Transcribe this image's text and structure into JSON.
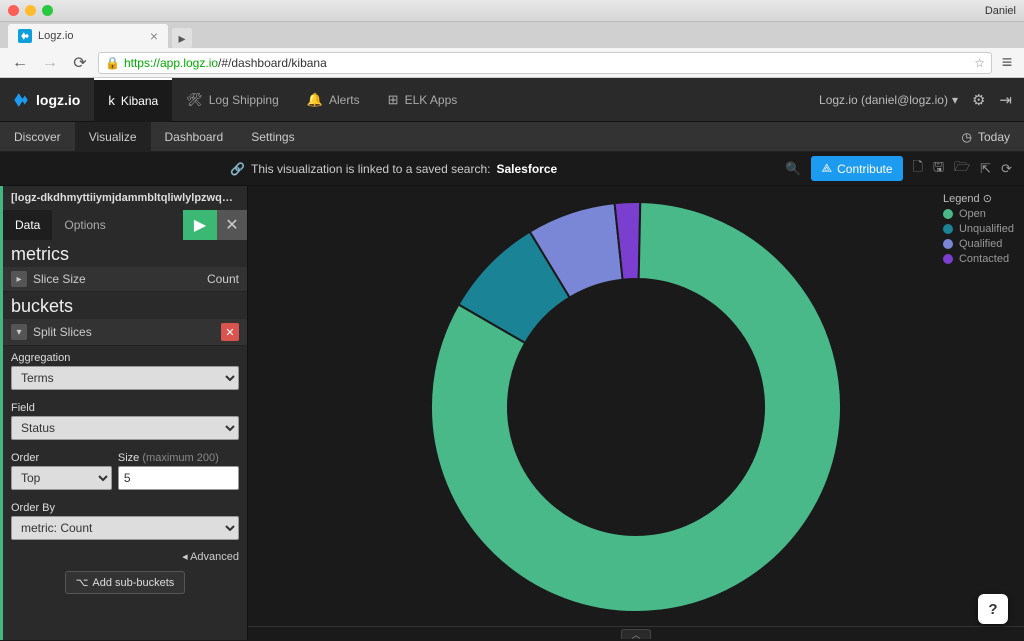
{
  "mac": {
    "user": "Daniel"
  },
  "browser": {
    "tab_title": "Logz.io",
    "url_secure": "https://",
    "url_host": "app.logz.io",
    "url_path": "/#/dashboard/kibana"
  },
  "topnav": {
    "logo": "logz.io",
    "items": [
      "Kibana",
      "Log Shipping",
      "Alerts",
      "ELK Apps"
    ],
    "user_label": "Logz.io (daniel@logz.io)"
  },
  "subnav": {
    "items": [
      "Discover",
      "Visualize",
      "Dashboard",
      "Settings"
    ],
    "today": "Today"
  },
  "banner": {
    "text": "This visualization is linked to a saved search:",
    "search_name": "Salesforce",
    "contribute": "Contribute"
  },
  "left": {
    "index_pattern": "[logz-dkdhmyttiiymjdammbltqliwlylpzwqb-]YYMMDD",
    "tab_data": "Data",
    "tab_options": "Options",
    "metrics_header": "metrics",
    "slice_size": "Slice Size",
    "count": "Count",
    "buckets_header": "buckets",
    "split_slices": "Split Slices",
    "agg_label": "Aggregation",
    "agg_value": "Terms",
    "field_label": "Field",
    "field_value": "Status",
    "order_label": "Order",
    "order_value": "Top",
    "size_label": "Size",
    "size_hint": "(maximum 200)",
    "size_value": "5",
    "orderby_label": "Order By",
    "orderby_value": "metric: Count",
    "advanced": "◂ Advanced",
    "add_sub": "Add sub-buckets"
  },
  "legend": {
    "title": "Legend ⊙",
    "items": [
      {
        "label": "Open",
        "color": "#49b98a"
      },
      {
        "label": "Unqualified",
        "color": "#1b8396"
      },
      {
        "label": "Qualified",
        "color": "#7a86d6"
      },
      {
        "label": "Contacted",
        "color": "#7b3fd0"
      }
    ]
  },
  "chart_data": {
    "type": "pie",
    "donut": true,
    "series": [
      {
        "name": "Open",
        "value": 83,
        "color": "#49b98a"
      },
      {
        "name": "Unqualified",
        "value": 8,
        "color": "#1b8396"
      },
      {
        "name": "Qualified",
        "value": 7,
        "color": "#7a86d6"
      },
      {
        "name": "Contacted",
        "value": 2,
        "color": "#7b3fd0"
      }
    ]
  }
}
